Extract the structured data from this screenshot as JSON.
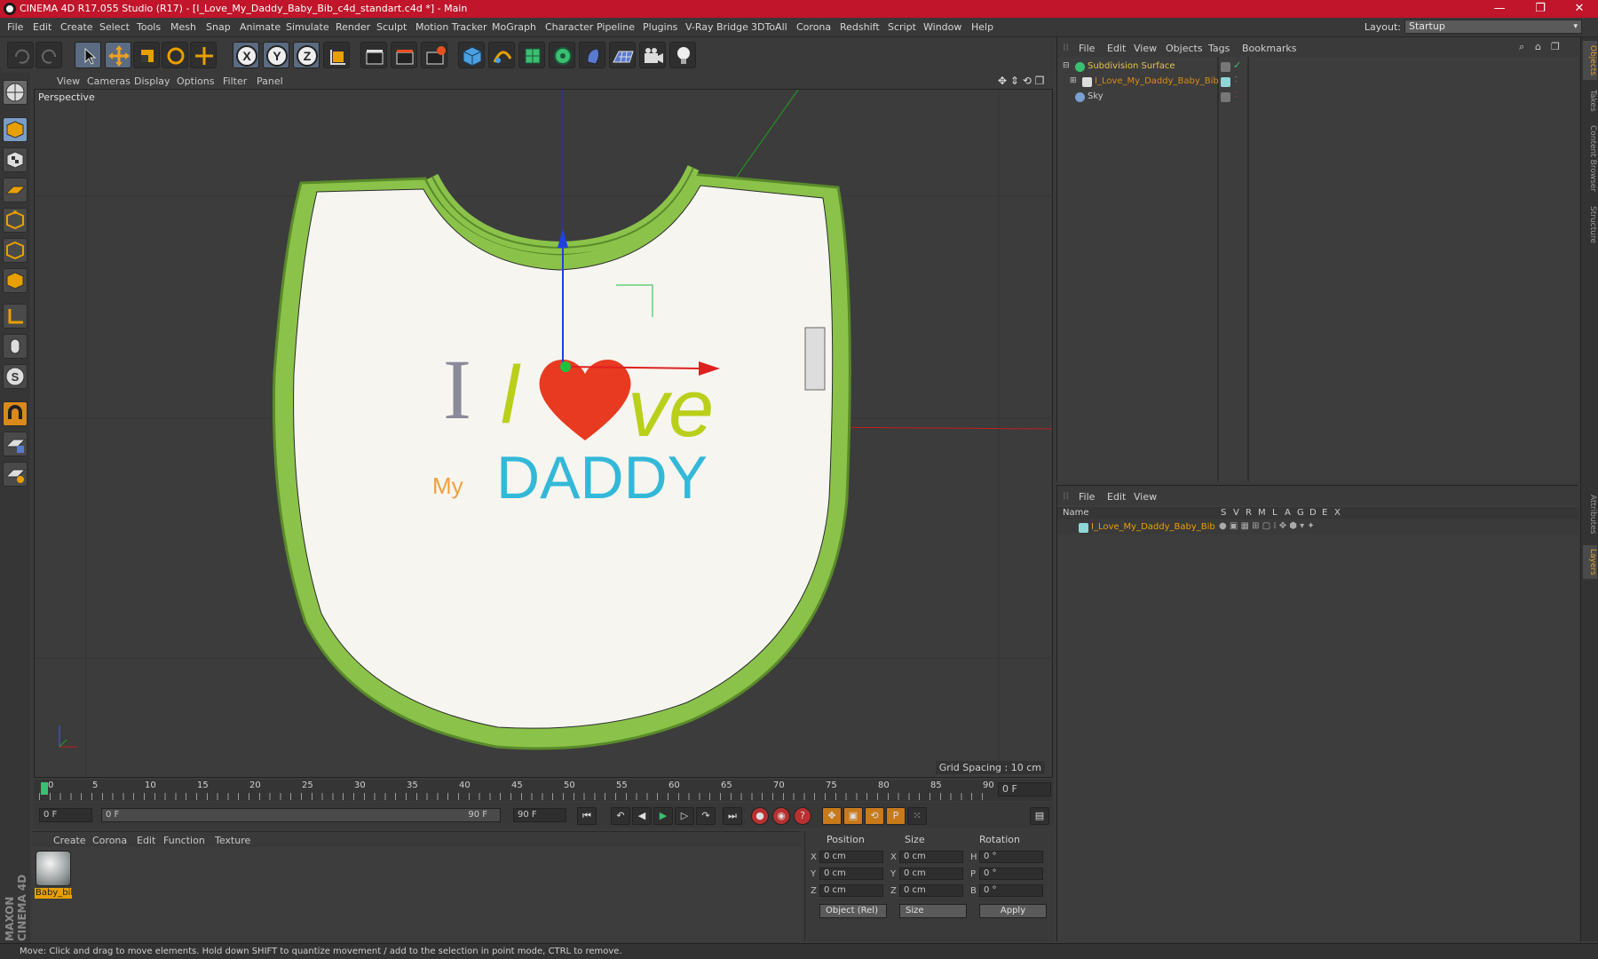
{
  "window": {
    "title": "CINEMA 4D R17.055 Studio (R17) - [I_Love_My_Daddy_Baby_Bib_c4d_standart.c4d *] - Main",
    "minimize": "—",
    "restore": "❐",
    "close": "✕"
  },
  "menubar": {
    "items": [
      "File",
      "Edit",
      "Create",
      "Select",
      "Tools",
      "Mesh",
      "Snap",
      "Animate",
      "Simulate",
      "Render",
      "Sculpt",
      "Motion Tracker",
      "MoGraph",
      "Character",
      "Pipeline",
      "Plugins",
      "V-Ray Bridge",
      "3DToAll",
      "Corona",
      "Redshift",
      "Script",
      "Window",
      "Help"
    ],
    "layout_label": "Layout:",
    "layout_value": "Startup"
  },
  "toolbar": {
    "axis_x": "X",
    "axis_y": "Y",
    "axis_z": "Z"
  },
  "viewport": {
    "menu": [
      "View",
      "Cameras",
      "Display",
      "Options",
      "Filter",
      "Panel"
    ],
    "camera_label": "Perspective",
    "grid_spacing": "Grid Spacing : 10 cm",
    "bib_text": {
      "line1_i": "I",
      "line1_l": "l",
      "line1_ve": "ve",
      "line2_prefix": "My",
      "line2_name": "DADDY"
    }
  },
  "timeline": {
    "ticks": [
      "0",
      "5",
      "10",
      "15",
      "20",
      "25",
      "30",
      "35",
      "40",
      "45",
      "50",
      "55",
      "60",
      "65",
      "70",
      "75",
      "80",
      "85",
      "90"
    ],
    "current_frame_field": "0 F",
    "start_field": "0 F",
    "range_start": "0 F",
    "range_end": "90 F",
    "end_field": "90 F"
  },
  "material_manager": {
    "menu": [
      "Create",
      "Corona",
      "Edit",
      "Function",
      "Texture"
    ],
    "material_name": "Baby_bil"
  },
  "coordinates": {
    "headers": {
      "position": "Position",
      "size": "Size",
      "rotation": "Rotation"
    },
    "rows": [
      {
        "axis": "X",
        "pos": "0 cm",
        "size_axis": "X",
        "size": "0 cm",
        "rot_axis": "H",
        "rot": "0 °"
      },
      {
        "axis": "Y",
        "pos": "0 cm",
        "size_axis": "Y",
        "size": "0 cm",
        "rot_axis": "P",
        "rot": "0 °"
      },
      {
        "axis": "Z",
        "pos": "0 cm",
        "size_axis": "Z",
        "size": "0 cm",
        "rot_axis": "B",
        "rot": "0 °"
      }
    ],
    "mode_dropdown": "Object (Rel)",
    "size_dropdown": "Size",
    "apply_label": "Apply"
  },
  "object_manager": {
    "menu": [
      "File",
      "Edit",
      "View",
      "Objects",
      "Tags",
      "Bookmarks"
    ],
    "objects": [
      {
        "name": "Subdivision Surface",
        "color": "#e6c34a"
      },
      {
        "name": "I_Love_My_Daddy_Baby_Bib",
        "color": "#d98a1a"
      },
      {
        "name": "Sky",
        "color": "#c8c8c8"
      }
    ]
  },
  "layer_manager": {
    "menu": [
      "File",
      "Edit",
      "View"
    ],
    "columns": [
      "Name",
      "S",
      "V",
      "R",
      "M",
      "L",
      "A",
      "G",
      "D",
      "E",
      "X"
    ],
    "layer_name": "I_Love_My_Daddy_Baby_Bib"
  },
  "right_tabs": [
    "Objects",
    "Takes",
    "Content Browser",
    "Structure",
    "Attributes",
    "Layers"
  ],
  "status": {
    "text": "Move: Click and drag to move elements. Hold down SHIFT to quantize movement / add to the selection in point mode, CTRL to remove."
  },
  "branding": {
    "logo": "MAXON CINEMA 4D"
  },
  "colors": {
    "title_bar": "#c0152a",
    "accent_orange": "#e8a000",
    "bib_trim": "#8bc34a"
  }
}
